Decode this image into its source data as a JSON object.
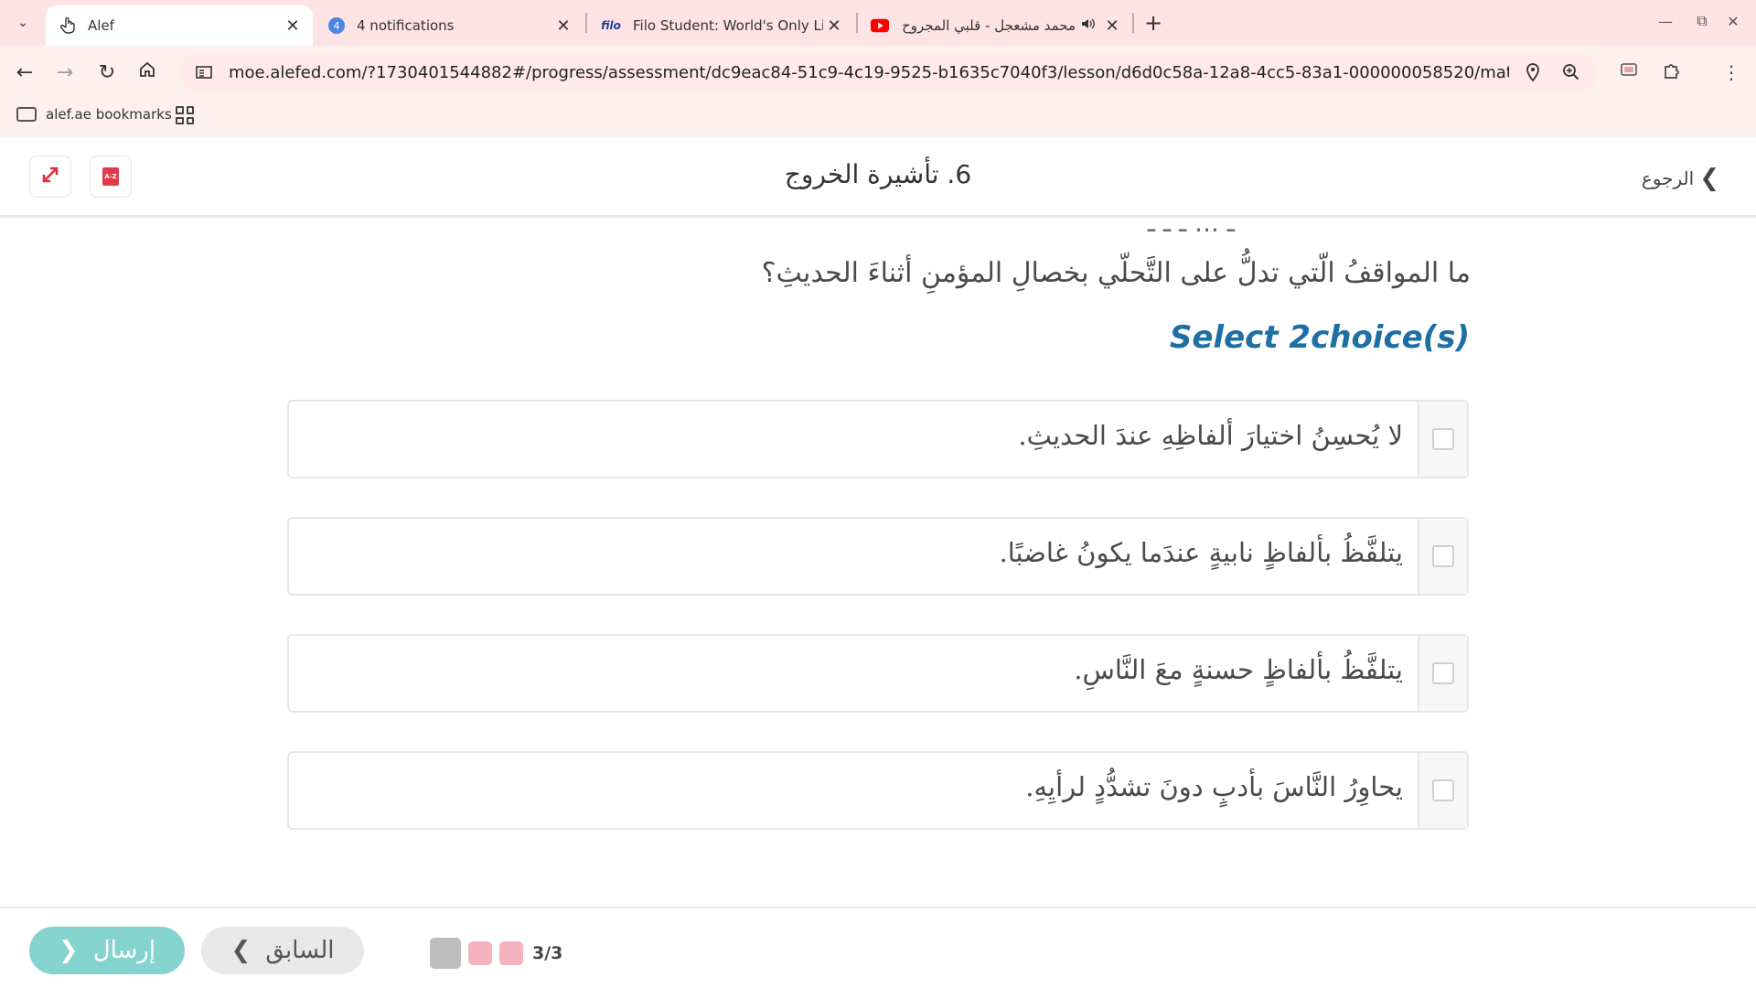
{
  "browser": {
    "tabs": [
      {
        "title": "Alef",
        "icon": "hand-pointer-icon",
        "active": true
      },
      {
        "title": "4 notifications",
        "badge": "4",
        "icon": "notification-badge-icon",
        "active": false
      },
      {
        "title": "Filo Student: World's Only Live I",
        "favicon_text": "filo",
        "icon": "filo-icon",
        "active": false
      },
      {
        "title": "محمد مشعجل - قلبي المجروح",
        "icon": "youtube-icon",
        "audio": true,
        "active": false
      }
    ],
    "url": "moe.alefed.com/?1730401544882#/progress/assessment/dc9eac84-51c9-4c19-9525-b1635c7040f3/lesson/d6d0c58a-12a8-4cc5-83a1-000000058520/material/6aace87a-0a27-...",
    "bookmarks": [
      {
        "label": "alef.ae bookmarks",
        "icon": "folder-icon"
      }
    ],
    "colors": {
      "tabbar": "#fde3e3",
      "toolbar": "#fff0f0",
      "omnibox": "#ffe9ea"
    }
  },
  "header": {
    "title": "6. تأشيرة الخروج",
    "back_label": "الرجوع",
    "buttons": [
      {
        "icon": "expand-icon"
      },
      {
        "icon": "dictionary-icon",
        "text": "A-Z"
      }
    ]
  },
  "question": {
    "cut_text": "ـ ... ـ ـ ـ",
    "text": "ما المواقفُ الّتي تدلُّ على التَّحلّي بخصالِ المؤمنِ أثناءَ الحديثِ؟",
    "instruction": "Select 2choice(s)",
    "choices": [
      {
        "text": "لا يُحسِنُ اختيارَ ألفاظِهِ عندَ الحديثِ.",
        "checked": false
      },
      {
        "text": "يتلفَّظُ بألفاظٍ نابيةٍ عندَما يكونُ غاضبًا.",
        "checked": false
      },
      {
        "text": "يتلفَّظُ بألفاظٍ حسنةٍ معَ النَّاسِ.",
        "checked": false
      },
      {
        "text": "يحاوِرُ النَّاسَ بأدبٍ دونَ تشدُّدٍ لرأيِهِ.",
        "checked": false
      }
    ]
  },
  "footer": {
    "send_label": "إرسال",
    "prev_label": "السابق",
    "progress": "3/3",
    "progress_colors": [
      "#bdbdbd",
      "#f4b3bd",
      "#f4b3bd"
    ],
    "send_color": "#84d3cf",
    "accent": "#1d6fa5"
  }
}
